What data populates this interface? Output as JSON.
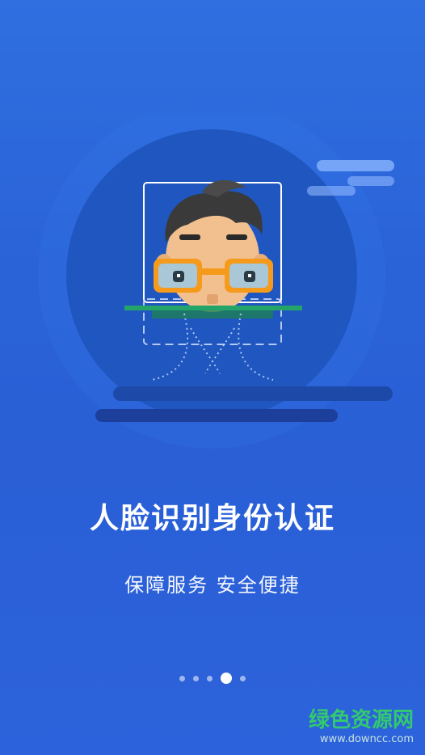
{
  "intro": {
    "title": "人脸识别身份认证",
    "subtitle": "保障服务 安全便捷"
  },
  "pagination": {
    "active_index": 3,
    "count": 5
  },
  "watermark": {
    "brand": "绿色资源网",
    "url": "www.downcc.com"
  },
  "colors": {
    "background": "#2a63d8",
    "circle": "#1f56bf",
    "glasses": "#f59a1b",
    "hair": "#3a3a3a",
    "skin": "#f2c08f",
    "scan_green": "#25a46a",
    "text": "#ffffff"
  }
}
